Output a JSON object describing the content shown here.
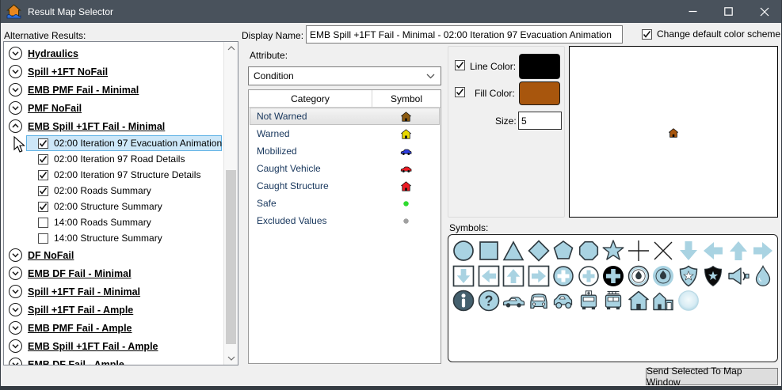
{
  "window": {
    "title": "Result Map Selector"
  },
  "titlebar": {
    "minimize": "minimize",
    "maximize": "maximize",
    "close": "close"
  },
  "alternative_results": {
    "label": "Alternative Results:",
    "tree": [
      {
        "type": "header",
        "label": "Hydraulics",
        "expanded": false
      },
      {
        "type": "header",
        "label": "Spill +1FT NoFail",
        "expanded": false
      },
      {
        "type": "header",
        "label": "EMB PMF Fail - Minimal",
        "expanded": false
      },
      {
        "type": "header",
        "label": "PMF NoFail",
        "expanded": false
      },
      {
        "type": "header",
        "label": "EMB Spill +1FT Fail - Minimal",
        "expanded": true
      },
      {
        "type": "item",
        "label": "02:00 Iteration 97 Evacuation Animation",
        "checked": true,
        "selected": true
      },
      {
        "type": "item",
        "label": "02:00 Iteration 97 Road Details",
        "checked": true,
        "selected": false
      },
      {
        "type": "item",
        "label": "02:00 Iteration 97 Structure Details",
        "checked": true,
        "selected": false
      },
      {
        "type": "item",
        "label": "02:00 Roads Summary",
        "checked": true,
        "selected": false
      },
      {
        "type": "item",
        "label": "02:00 Structure Summary",
        "checked": true,
        "selected": false
      },
      {
        "type": "item",
        "label": "14:00 Roads Summary",
        "checked": false,
        "selected": false
      },
      {
        "type": "item",
        "label": "14:00 Structure Summary",
        "checked": false,
        "selected": false
      },
      {
        "type": "header",
        "label": "DF NoFail",
        "expanded": false
      },
      {
        "type": "header",
        "label": "EMB DF Fail - Minimal",
        "expanded": false
      },
      {
        "type": "header",
        "label": "Spill +1FT Fail - Minimal",
        "expanded": false
      },
      {
        "type": "header",
        "label": "Spill +1FT Fail - Ample",
        "expanded": false
      },
      {
        "type": "header",
        "label": "EMB PMF Fail - Ample",
        "expanded": false
      },
      {
        "type": "header",
        "label": "EMB Spill +1FT Fail - Ample",
        "expanded": false
      },
      {
        "type": "header",
        "label": "EMB DF Fail - Ample",
        "expanded": false
      }
    ]
  },
  "display_name": {
    "label": "Display Name:",
    "value": "EMB Spill +1FT Fail - Minimal - 02:00 Iteration 97 Evacuation Animation"
  },
  "change_color_scheme": {
    "label": "Change default color scheme",
    "checked": true
  },
  "attribute": {
    "label": "Attribute:",
    "value": "Condition"
  },
  "category_table": {
    "columns": [
      "Category",
      "Symbol"
    ],
    "rows": [
      {
        "label": "Not Warned",
        "symbol": "house",
        "color": "#8B5A10",
        "selected": true
      },
      {
        "label": "Warned",
        "symbol": "house",
        "color": "#E8D800",
        "selected": false
      },
      {
        "label": "Mobilized",
        "symbol": "car",
        "color": "#2F3FE3",
        "selected": false
      },
      {
        "label": "Caught Vehicle",
        "symbol": "car",
        "color": "#EC1C24",
        "selected": false
      },
      {
        "label": "Caught Structure",
        "symbol": "house",
        "color": "#EC1C24",
        "selected": false
      },
      {
        "label": "Safe",
        "symbol": "dot",
        "color": "#2EDB2E",
        "selected": false
      },
      {
        "label": "Excluded Values",
        "symbol": "dot",
        "color": "#A0A0A0",
        "selected": false
      }
    ]
  },
  "style_panel": {
    "line_color": {
      "label": "Line Color:",
      "checked": true,
      "color": "#000000"
    },
    "fill_color": {
      "label": "Fill Color:",
      "checked": true,
      "color": "#A8560D"
    },
    "size": {
      "label": "Size:",
      "value": "5"
    }
  },
  "preview": {
    "symbol": "house",
    "fill": "#A8560D",
    "line": "#000000"
  },
  "symbols": {
    "label": "Symbols:",
    "items": [
      "circle",
      "square",
      "triangle",
      "diamond",
      "pentagon",
      "octagon",
      "star",
      "plus",
      "x-cross",
      "arrow-down",
      "arrow-left",
      "arrow-up",
      "arrow-right",
      "arrow-down-box",
      "arrow-left-box",
      "arrow-up-box",
      "arrow-right-box",
      "circle-cross-white",
      "circle-cross-blue",
      "circle-cross-black",
      "fire-badge",
      "fire-badge-filled",
      "police-badge",
      "police-badge-black",
      "siren",
      "droplet",
      "info-circle",
      "question-circle",
      "car-sedan",
      "car-front",
      "car-side",
      "ambulance",
      "fire-truck",
      "house",
      "house-garage",
      "glow-circle"
    ]
  },
  "send_button": {
    "label": "Send Selected To Map Window"
  },
  "colors": {
    "titlebar": "#49525C",
    "selection_bg": "#CDE7F8",
    "selection_border": "#5FB2E5",
    "symbol_blue": "#A9D3E2",
    "category_text": "#17365C"
  }
}
